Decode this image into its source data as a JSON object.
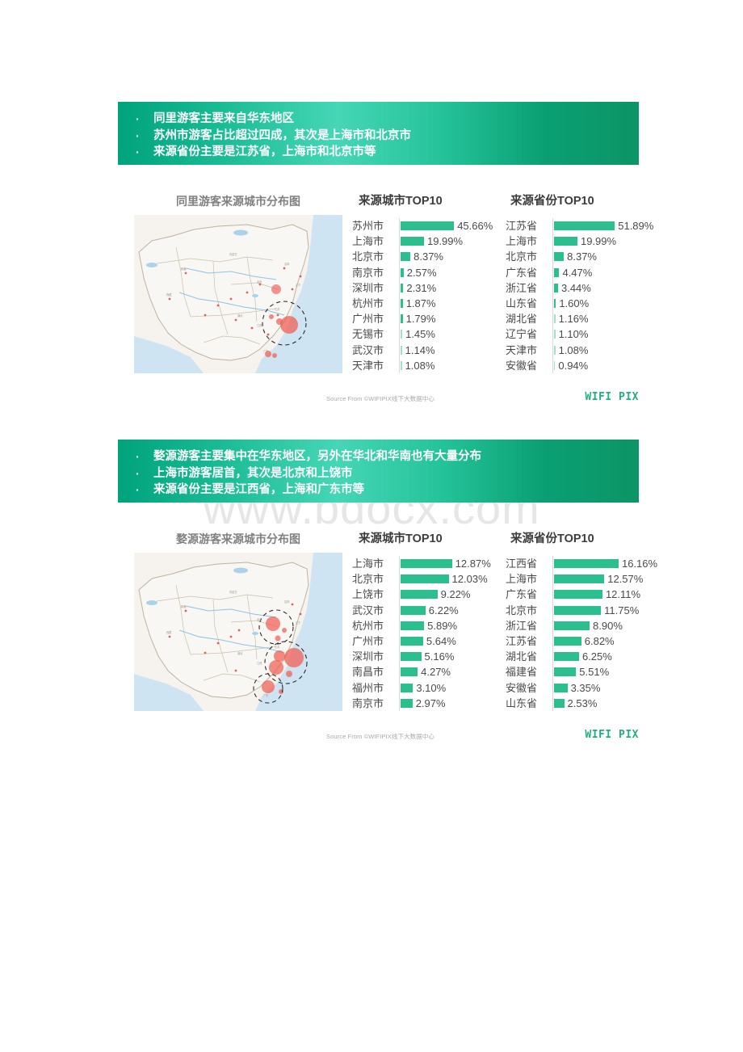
{
  "page": {
    "watermark": "www.bdocx.com",
    "accent_green": "#2bbf8e",
    "header_gradient_from": "#00a37b",
    "header_gradient_to": "#0c9565"
  },
  "sections": [
    {
      "id": "tongli",
      "bullets": [
        "同里游客主要来自华东地区",
        "苏州市游客占比超过四成，其次是上海市和北京市",
        "来源省份主要是江苏省，上海市和北京市等"
      ],
      "map_title": "同里游客来源城市分布图",
      "city_chart": {
        "title": "来源城市TOP10",
        "labels": [
          "苏州市",
          "上海市",
          "北京市",
          "南京市",
          "深圳市",
          "杭州市",
          "广州市",
          "无锡市",
          "武汉市",
          "天津市"
        ],
        "values": [
          45.66,
          19.99,
          8.37,
          2.57,
          2.31,
          1.87,
          1.79,
          1.45,
          1.14,
          1.08
        ],
        "display": [
          "45.66%",
          "19.99%",
          "8.37%",
          "2.57%",
          "2.31%",
          "1.87%",
          "1.79%",
          "1.45%",
          "1.14%",
          "1.08%"
        ]
      },
      "province_chart": {
        "title": "来源省份TOP10",
        "labels": [
          "江苏省",
          "上海市",
          "北京市",
          "广东省",
          "浙江省",
          "山东省",
          "湖北省",
          "辽宁省",
          "天津市",
          "安徽省"
        ],
        "values": [
          51.89,
          19.99,
          8.37,
          4.47,
          3.44,
          1.6,
          1.16,
          1.1,
          1.08,
          0.94
        ],
        "display": [
          "51.89%",
          "19.99%",
          "8.37%",
          "4.47%",
          "3.44%",
          "1.60%",
          "1.16%",
          "1.10%",
          "1.08%",
          "0.94%"
        ]
      },
      "source": "Source From ©WIFIPIX线下大数据中心",
      "logo": "WIFI PIX"
    },
    {
      "id": "wuyuan",
      "bullets": [
        "婺源游客主要集中在华东地区，另外在华北和华南也有大量分布",
        "上海市游客居首，其次是北京和上饶市",
        "来源省份主要是江西省，上海和广东市等"
      ],
      "map_title": "婺源游客来源城市分布图",
      "city_chart": {
        "title": "来源城市TOP10",
        "labels": [
          "上海市",
          "北京市",
          "上饶市",
          "武汉市",
          "杭州市",
          "广州市",
          "深圳市",
          "南昌市",
          "福州市",
          "南京市"
        ],
        "values": [
          12.87,
          12.03,
          9.22,
          6.22,
          5.89,
          5.64,
          5.16,
          4.27,
          3.1,
          2.97
        ],
        "display": [
          "12.87%",
          "12.03%",
          "9.22%",
          "6.22%",
          "5.89%",
          "5.64%",
          "5.16%",
          "4.27%",
          "3.10%",
          "2.97%"
        ]
      },
      "province_chart": {
        "title": "来源省份TOP10",
        "labels": [
          "江西省",
          "上海市",
          "广东省",
          "北京市",
          "浙江省",
          "江苏省",
          "湖北省",
          "福建省",
          "安徽省",
          "山东省"
        ],
        "values": [
          16.16,
          12.57,
          12.11,
          11.75,
          8.9,
          6.82,
          6.25,
          5.51,
          3.35,
          2.53
        ],
        "display": [
          "16.16%",
          "12.57%",
          "12.11%",
          "11.75%",
          "8.90%",
          "6.82%",
          "6.25%",
          "5.51%",
          "3.35%",
          "2.53%"
        ]
      },
      "source": "Source From ©WIFIPIX线下大数据中心",
      "logo": "WIFI PIX"
    }
  ],
  "chart_data": [
    {
      "type": "bar",
      "title": "来源城市TOP10",
      "subtitle": "同里游客来源城市分布图",
      "orientation": "horizontal",
      "categories": [
        "苏州市",
        "上海市",
        "北京市",
        "南京市",
        "深圳市",
        "杭州市",
        "广州市",
        "无锡市",
        "武汉市",
        "天津市"
      ],
      "values": [
        45.66,
        19.99,
        8.37,
        2.57,
        2.31,
        1.87,
        1.79,
        1.45,
        1.14,
        1.08
      ],
      "unit": "%",
      "xlabel": "",
      "ylabel": "",
      "xlim": [
        0,
        51.89
      ],
      "grid": false,
      "legend": "none"
    },
    {
      "type": "bar",
      "title": "来源省份TOP10",
      "subtitle": "同里游客来源省份",
      "orientation": "horizontal",
      "categories": [
        "江苏省",
        "上海市",
        "北京市",
        "广东省",
        "浙江省",
        "山东省",
        "湖北省",
        "辽宁省",
        "天津市",
        "安徽省"
      ],
      "values": [
        51.89,
        19.99,
        8.37,
        4.47,
        3.44,
        1.6,
        1.16,
        1.1,
        1.08,
        0.94
      ],
      "unit": "%",
      "xlabel": "",
      "ylabel": "",
      "xlim": [
        0,
        51.89
      ],
      "grid": false,
      "legend": "none"
    },
    {
      "type": "bar",
      "title": "来源城市TOP10",
      "subtitle": "婺源游客来源城市分布图",
      "orientation": "horizontal",
      "categories": [
        "上海市",
        "北京市",
        "上饶市",
        "武汉市",
        "杭州市",
        "广州市",
        "深圳市",
        "南昌市",
        "福州市",
        "南京市"
      ],
      "values": [
        12.87,
        12.03,
        9.22,
        6.22,
        5.89,
        5.64,
        5.16,
        4.27,
        3.1,
        2.97
      ],
      "unit": "%",
      "xlabel": "",
      "ylabel": "",
      "xlim": [
        0,
        16.16
      ],
      "grid": false,
      "legend": "none"
    },
    {
      "type": "bar",
      "title": "来源省份TOP10",
      "subtitle": "婺源游客来源省份",
      "orientation": "horizontal",
      "categories": [
        "江西省",
        "上海市",
        "广东省",
        "北京市",
        "浙江省",
        "江苏省",
        "湖北省",
        "福建省",
        "安徽省",
        "山东省"
      ],
      "values": [
        16.16,
        12.57,
        12.11,
        11.75,
        8.9,
        6.82,
        6.25,
        5.51,
        3.35,
        2.53
      ],
      "unit": "%",
      "xlabel": "",
      "ylabel": "",
      "xlim": [
        0,
        16.16
      ],
      "grid": false,
      "legend": "none"
    }
  ]
}
